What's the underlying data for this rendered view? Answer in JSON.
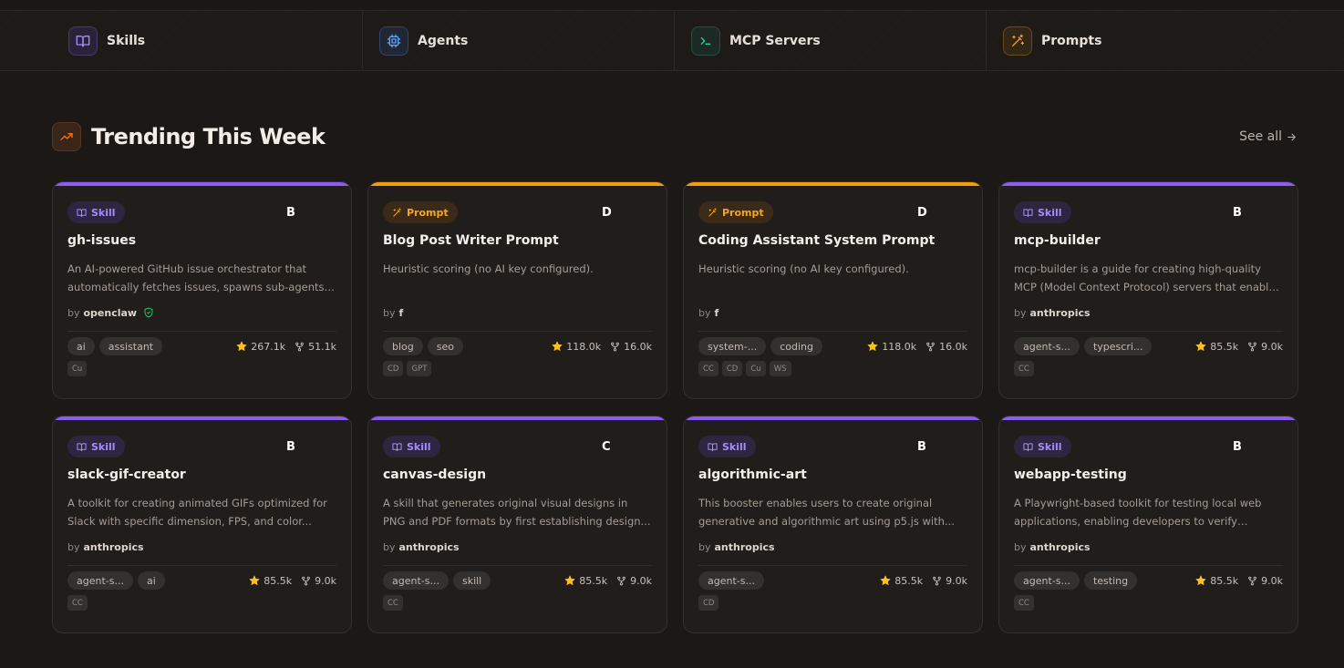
{
  "categories": [
    {
      "label": "Skills",
      "icon": "book-icon",
      "color": "#a78bfa"
    },
    {
      "label": "Agents",
      "icon": "cpu-icon",
      "color": "#60a5fa"
    },
    {
      "label": "MCP Servers",
      "icon": "terminal-icon",
      "color": "#34d399"
    },
    {
      "label": "Prompts",
      "icon": "wand-icon",
      "color": "#f5a524"
    }
  ],
  "section": {
    "title": "Trending This Week",
    "see_all": "See all",
    "icon": "trending-up-icon"
  },
  "colors": {
    "skill": "#8b5cf6",
    "prompt": "#f59e0b"
  },
  "cards": [
    {
      "type": "Skill",
      "grade": "B",
      "title": "gh-issues",
      "desc": "An AI-powered GitHub issue orchestrator that automatically fetches issues, spawns sub-agents to...",
      "by": "by",
      "author": "openclaw",
      "verified": true,
      "tags": [
        "ai",
        "assistant"
      ],
      "stars": "267.1k",
      "forks": "51.1k",
      "platforms": [
        "Cu"
      ]
    },
    {
      "type": "Prompt",
      "grade": "D",
      "title": "Blog Post Writer Prompt",
      "desc": "Heuristic scoring (no AI key configured).",
      "by": "by",
      "author": "f",
      "verified": false,
      "tags": [
        "blog",
        "seo"
      ],
      "stars": "118.0k",
      "forks": "16.0k",
      "platforms": [
        "CD",
        "GPT"
      ]
    },
    {
      "type": "Prompt",
      "grade": "D",
      "title": "Coding Assistant System Prompt",
      "desc": "Heuristic scoring (no AI key configured).",
      "by": "by",
      "author": "f",
      "verified": false,
      "tags": [
        "system-...",
        "coding"
      ],
      "stars": "118.0k",
      "forks": "16.0k",
      "platforms": [
        "CC",
        "CD",
        "Cu",
        "WS"
      ]
    },
    {
      "type": "Skill",
      "grade": "B",
      "title": "mcp-builder",
      "desc": "mcp-builder is a guide for creating high-quality MCP (Model Context Protocol) servers that enable LLMs...",
      "by": "by",
      "author": "anthropics",
      "verified": false,
      "tags": [
        "agent-s...",
        "typescri..."
      ],
      "stars": "85.5k",
      "forks": "9.0k",
      "platforms": [
        "CC"
      ]
    },
    {
      "type": "Skill",
      "grade": "B",
      "title": "slack-gif-creator",
      "desc": "A toolkit for creating animated GIFs optimized for Slack with specific dimension, FPS, and color...",
      "by": "by",
      "author": "anthropics",
      "verified": false,
      "tags": [
        "agent-s...",
        "ai"
      ],
      "stars": "85.5k",
      "forks": "9.0k",
      "platforms": [
        "CC"
      ]
    },
    {
      "type": "Skill",
      "grade": "C",
      "title": "canvas-design",
      "desc": "A skill that generates original visual designs in PNG and PDF formats by first establishing design...",
      "by": "by",
      "author": "anthropics",
      "verified": false,
      "tags": [
        "agent-s...",
        "skill"
      ],
      "stars": "85.5k",
      "forks": "9.0k",
      "platforms": [
        "CC"
      ]
    },
    {
      "type": "Skill",
      "grade": "B",
      "title": "algorithmic-art",
      "desc": "This booster enables users to create original generative and algorithmic art using p5.js with...",
      "by": "by",
      "author": "anthropics",
      "verified": false,
      "tags": [
        "agent-s..."
      ],
      "stars": "85.5k",
      "forks": "9.0k",
      "platforms": [
        "CD"
      ]
    },
    {
      "type": "Skill",
      "grade": "B",
      "title": "webapp-testing",
      "desc": "A Playwright-based toolkit for testing local web applications, enabling developers to verify frontend...",
      "by": "by",
      "author": "anthropics",
      "verified": false,
      "tags": [
        "agent-s...",
        "testing"
      ],
      "stars": "85.5k",
      "forks": "9.0k",
      "platforms": [
        "CC"
      ]
    }
  ]
}
